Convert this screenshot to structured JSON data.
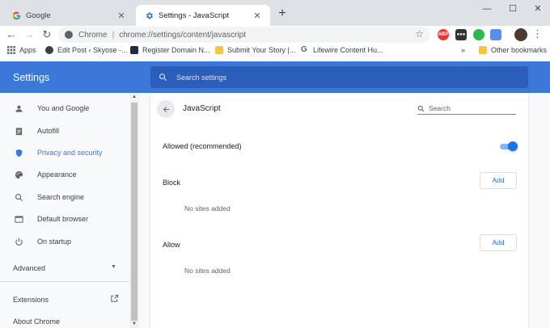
{
  "browser": {
    "tabs": [
      {
        "title": "Google",
        "favicon": "google-g-icon"
      },
      {
        "title": "Settings - JavaScript",
        "favicon": "gear-icon"
      }
    ],
    "omnibox": {
      "scheme": "Chrome",
      "url": "chrome://settings/content/javascript"
    },
    "extensions": [
      {
        "name": "abp-icon",
        "label": "ABP",
        "color": "#e53935"
      },
      {
        "name": "dark-extension-icon",
        "label": "●●●",
        "color": "#333333"
      },
      {
        "name": "evernote-icon",
        "label": "",
        "color": "#2db84d"
      },
      {
        "name": "blue-extension-icon",
        "label": "",
        "color": "#5b8de8"
      }
    ],
    "bookmarks": [
      {
        "label": "Apps",
        "icon": "apps-grid-icon"
      },
      {
        "label": "Edit Post ‹ Skyose -...",
        "icon": "wordpress-icon"
      },
      {
        "label": "Register Domain N...",
        "icon": "dark-square-icon"
      },
      {
        "label": "Submit Your Story |...",
        "icon": "yellow-doc-icon"
      },
      {
        "label": "Lifewire Content Hu...",
        "icon": "google-g-icon"
      }
    ],
    "bookmarks_overflow": "»",
    "other_bookmarks": "Other bookmarks"
  },
  "settings": {
    "title": "Settings",
    "search_placeholder": "Search settings",
    "nav": [
      {
        "label": "You and Google",
        "icon": "person-icon"
      },
      {
        "label": "Autofill",
        "icon": "clipboard-icon"
      },
      {
        "label": "Privacy and security",
        "icon": "shield-icon",
        "selected": true
      },
      {
        "label": "Appearance",
        "icon": "palette-icon"
      },
      {
        "label": "Search engine",
        "icon": "search-icon"
      },
      {
        "label": "Default browser",
        "icon": "browser-window-icon"
      },
      {
        "label": "On startup",
        "icon": "power-icon"
      }
    ],
    "advanced": "Advanced",
    "extensions": "Extensions",
    "about": "About Chrome"
  },
  "page": {
    "title": "JavaScript",
    "search_placeholder": "Search",
    "allowed_label": "Allowed (recommended)",
    "allowed_on": true,
    "block_label": "Block",
    "block_add": "Add",
    "block_empty": "No sites added",
    "allow_label": "Allow",
    "allow_add": "Add",
    "allow_empty": "No sites added"
  },
  "colors": {
    "accent": "#3c78d8",
    "header": "#3c78d8",
    "toggle": "#1a73e8"
  }
}
